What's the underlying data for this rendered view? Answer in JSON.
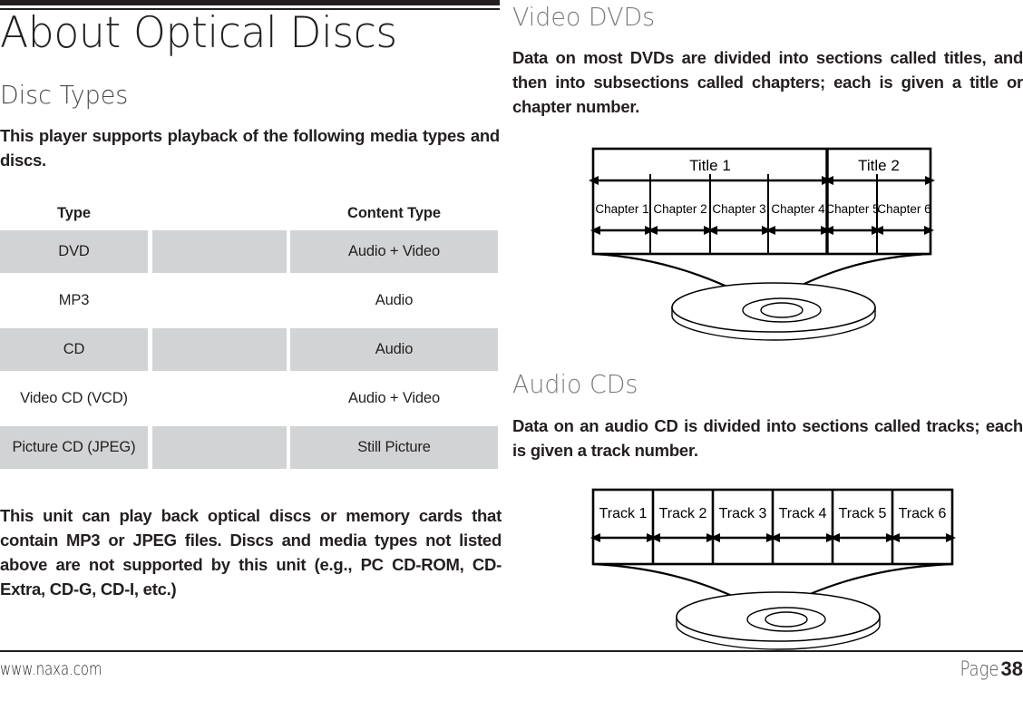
{
  "page": {
    "title": "About Optical Discs"
  },
  "left": {
    "section_heading": "Disc Types",
    "intro_paragraph": "This player supports playback of the following media types and discs.",
    "closing_paragraph": "This unit can play back optical discs or memory cards that contain MP3 or JPEG files. Discs and media types not listed above are not supported by this unit (e.g., PC CD-ROM, CD-Extra, CD-G, CD-I, etc.)",
    "table": {
      "headers": [
        "Type",
        "",
        "Content Type"
      ],
      "rows": [
        {
          "type": "DVD",
          "content": "Audio + Video",
          "shaded": true
        },
        {
          "type": "MP3",
          "content": "Audio",
          "shaded": false
        },
        {
          "type": "CD",
          "content": "Audio",
          "shaded": true
        },
        {
          "type": "Video CD (VCD)",
          "content": "Audio + Video",
          "shaded": false
        },
        {
          "type": "Picture CD (JPEG)",
          "content": "Still Picture",
          "shaded": true
        }
      ]
    }
  },
  "right": {
    "video_dvds": {
      "heading": "Video DVDs",
      "paragraph": "Data on most DVDs are divided into sections called titles, and then into subsections called chapters; each is given a title or chapter number.",
      "diagram": {
        "titles": [
          "Title 1",
          "Title 2"
        ],
        "chapters": [
          "Chapter 1",
          "Chapter 2",
          "Chapter 3",
          "Chapter 4",
          "Chapter 5",
          "Chapter 6"
        ],
        "disc_label": "optical-disc-illustration"
      }
    },
    "audio_cds": {
      "heading": "Audio CDs",
      "paragraph": "Data on an audio CD is divided into sections called tracks; each is given a track number.",
      "diagram": {
        "tracks": [
          "Track 1",
          "Track 2",
          "Track 3",
          "Track 4",
          "Track 5",
          "Track 6"
        ],
        "disc_label": "optical-disc-illustration"
      }
    }
  },
  "footer": {
    "url": "www.naxa.com",
    "page_word": "Page",
    "page_number": "38"
  },
  "colors": {
    "ink": "#231f20",
    "heading_gray": "#7b7b7f",
    "row_shade": "#d2d3d4",
    "rule": "#231f20"
  }
}
